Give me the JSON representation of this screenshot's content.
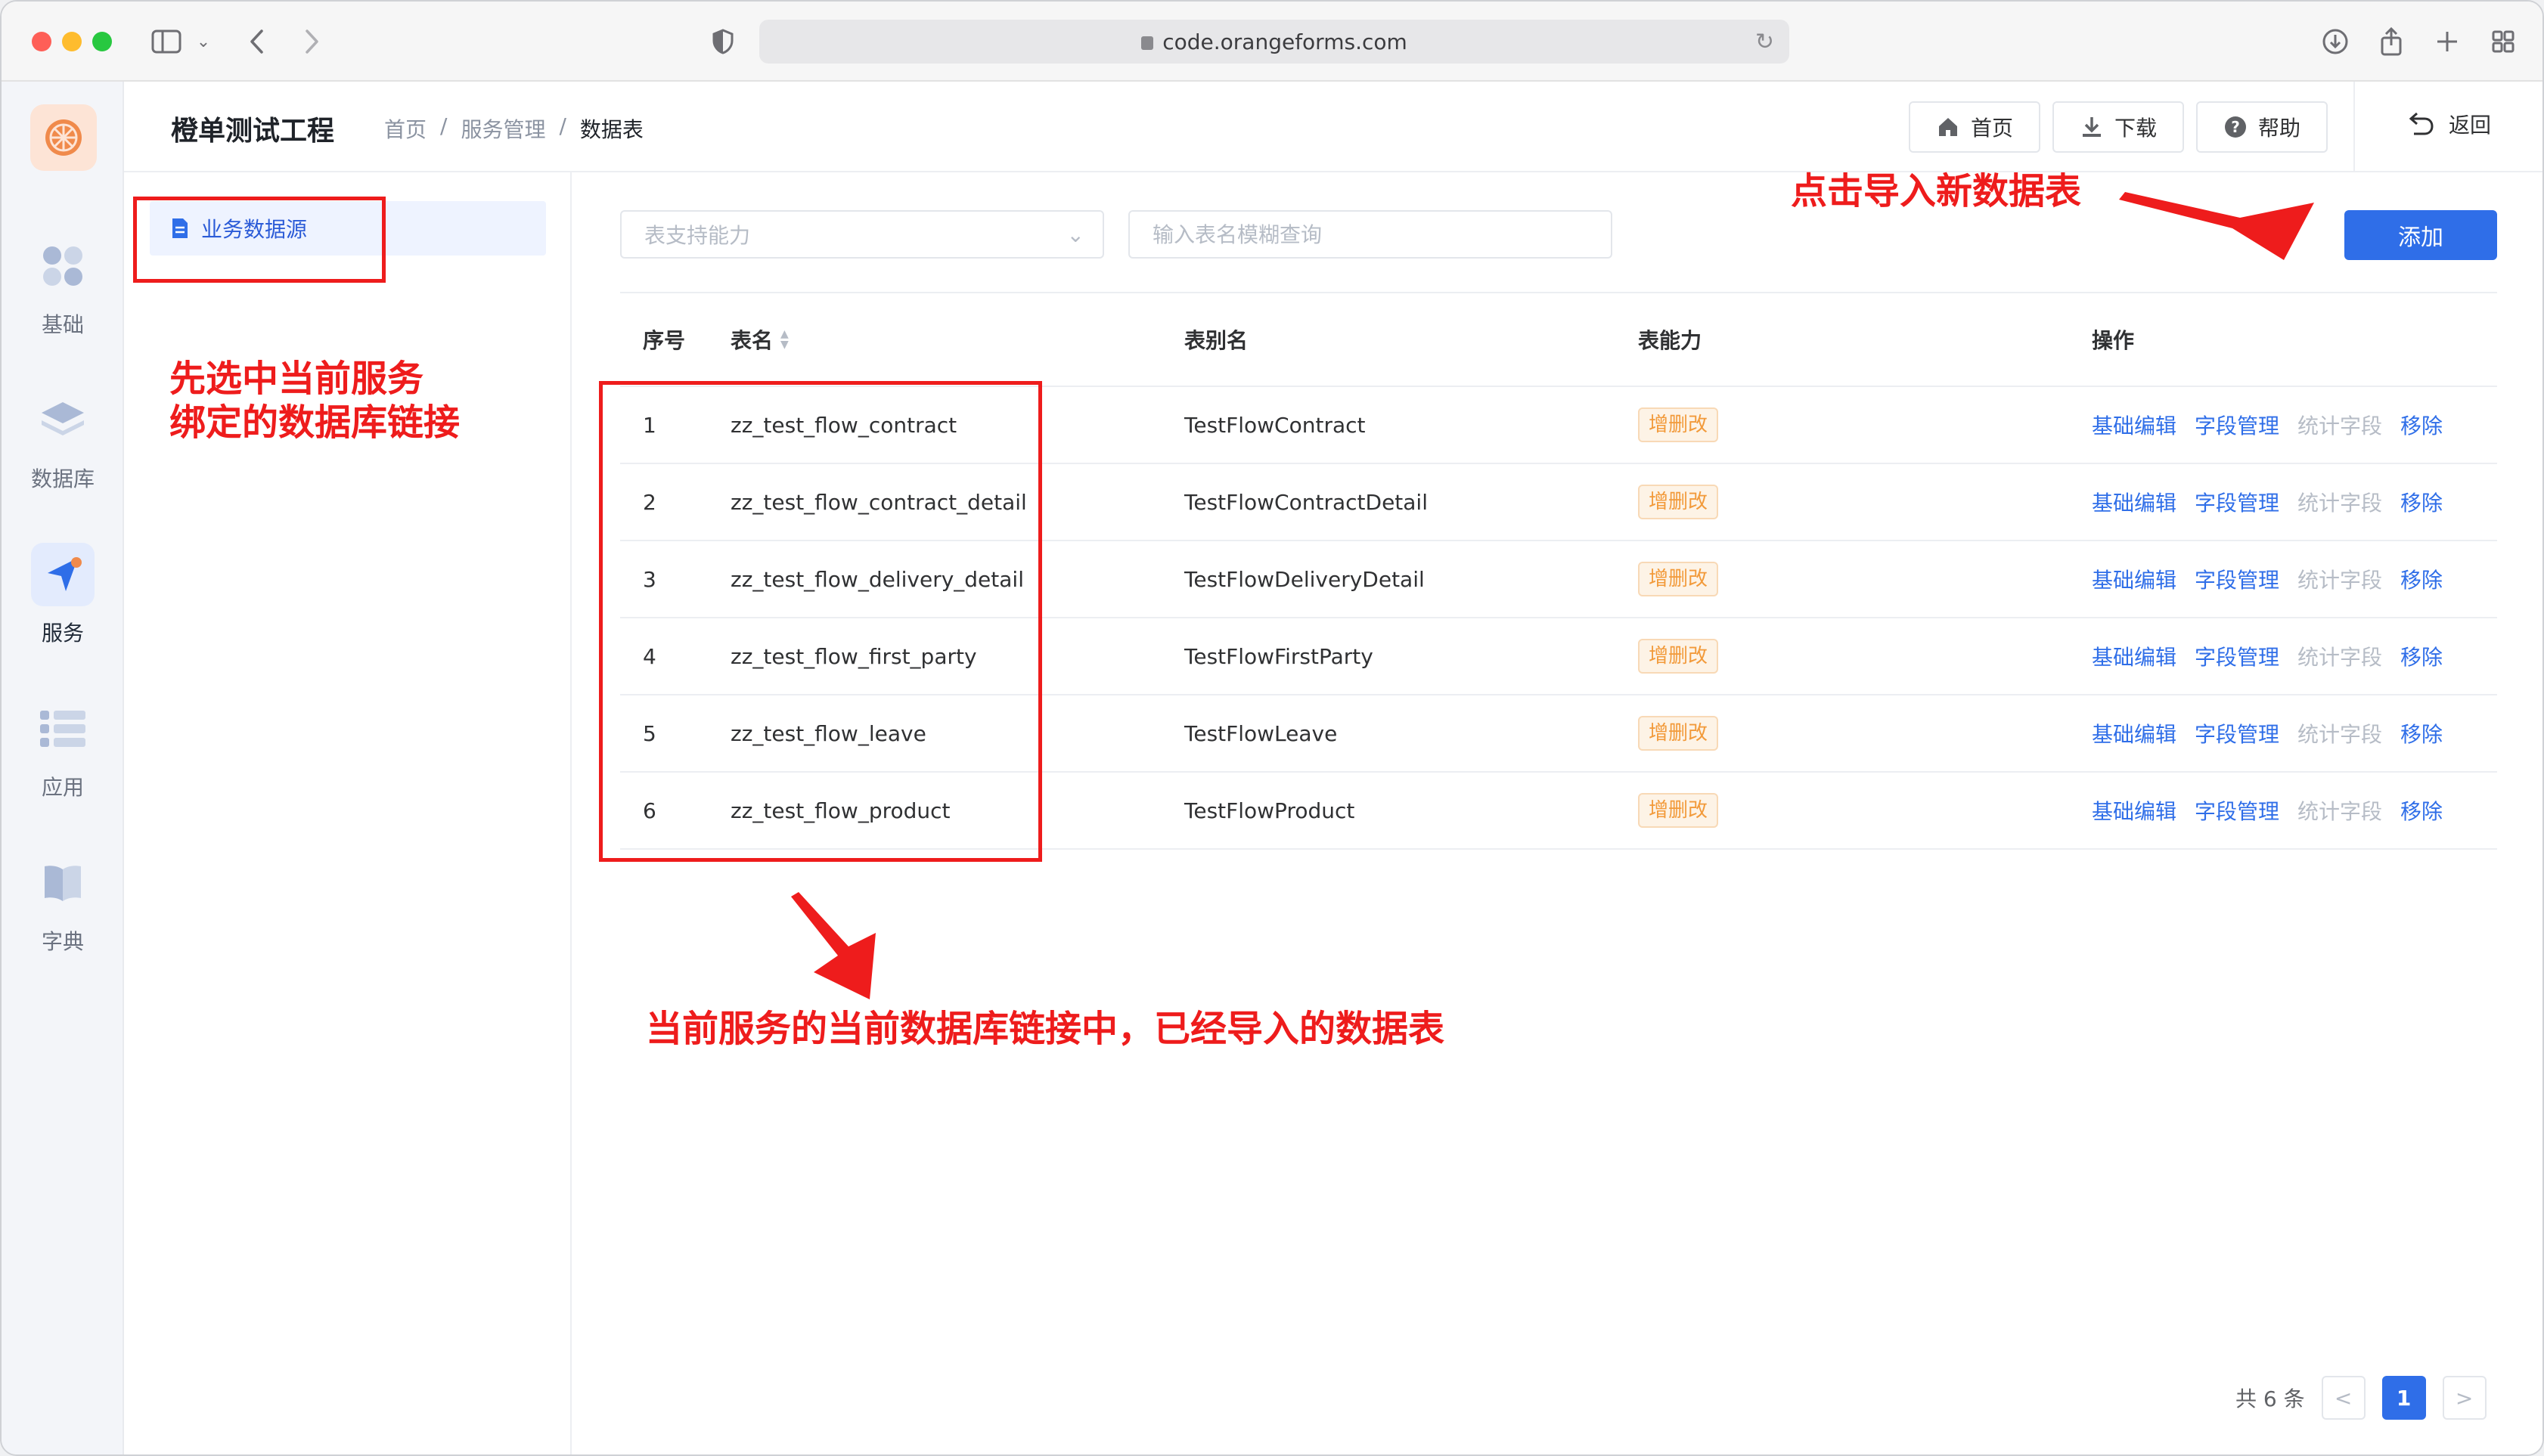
{
  "browser": {
    "url": "code.orangeforms.com"
  },
  "rail": {
    "items": [
      {
        "label": "基础"
      },
      {
        "label": "数据库"
      },
      {
        "label": "服务"
      },
      {
        "label": "应用"
      },
      {
        "label": "字典"
      }
    ]
  },
  "header": {
    "app_title": "橙单测试工程",
    "breadcrumb": [
      "首页",
      "/",
      "服务管理",
      "/",
      "数据表"
    ],
    "buttons": {
      "home": "首页",
      "download": "下载",
      "help": "帮助"
    },
    "back": "返回"
  },
  "sidebar": {
    "datasource": "业务数据源"
  },
  "filters": {
    "capability_placeholder": "表支持能力",
    "search_placeholder": "输入表名模糊查询",
    "add_label": "添加"
  },
  "table": {
    "columns": [
      "序号",
      "表名",
      "表别名",
      "表能力",
      "操作"
    ],
    "rows": [
      {
        "seq": "1",
        "name": "zz_test_flow_contract",
        "alias": "TestFlowContract",
        "cap": "增删改"
      },
      {
        "seq": "2",
        "name": "zz_test_flow_contract_detail",
        "alias": "TestFlowContractDetail",
        "cap": "增删改"
      },
      {
        "seq": "3",
        "name": "zz_test_flow_delivery_detail",
        "alias": "TestFlowDeliveryDetail",
        "cap": "增删改"
      },
      {
        "seq": "4",
        "name": "zz_test_flow_first_party",
        "alias": "TestFlowFirstParty",
        "cap": "增删改"
      },
      {
        "seq": "5",
        "name": "zz_test_flow_leave",
        "alias": "TestFlowLeave",
        "cap": "增删改"
      },
      {
        "seq": "6",
        "name": "zz_test_flow_product",
        "alias": "TestFlowProduct",
        "cap": "增删改"
      }
    ],
    "ops": {
      "edit": "基础编辑",
      "fields": "字段管理",
      "stats": "统计字段",
      "remove": "移除"
    }
  },
  "pagination": {
    "total": "共 6 条",
    "current": "1",
    "prev": "<",
    "next": ">"
  },
  "annotations": {
    "select_service_line1": "先选中当前服务",
    "select_service_line2": "绑定的数据库链接",
    "import_new": "点击导入新数据表",
    "imported_tables": "当前服务的当前数据库链接中，已经导入的数据表"
  },
  "colors": {
    "primary": "#2f6ee8",
    "annotation": "#ee1c1c",
    "tag": "#f29a3a"
  }
}
